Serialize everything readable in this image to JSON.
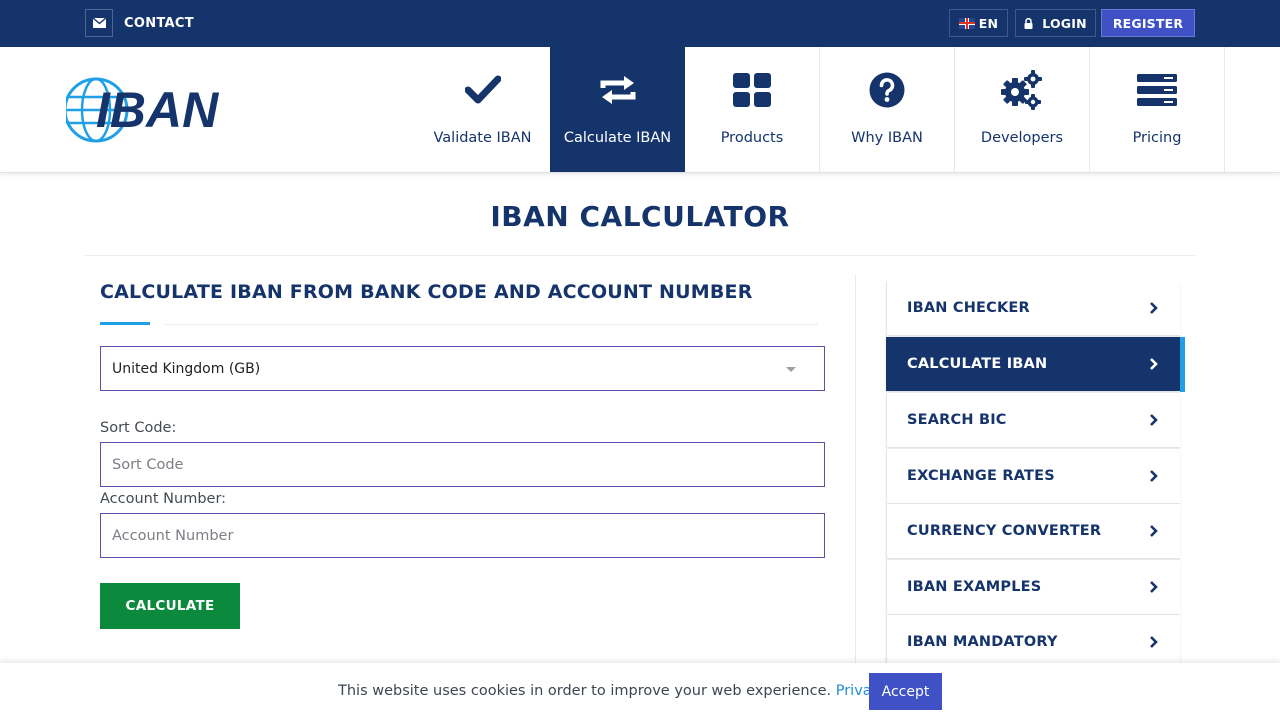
{
  "colors": {
    "navy": "#15346b",
    "topbar": "#15346b",
    "register": "#3f51c4",
    "accent_blue": "#1fa0e6",
    "calculate_green": "#0b8a3e",
    "input_border": "#5a4fb0"
  },
  "topbar": {
    "contact_label": "CONTACT",
    "contact_icon": "envelope-icon",
    "lang_label": "EN",
    "login_label": "LOGIN",
    "login_icon": "lock-icon",
    "register_label": "REGISTER"
  },
  "header": {
    "logo_text": "IBAN",
    "nav": [
      {
        "label": "Validate IBAN",
        "icon": "checkmark-icon",
        "active": false
      },
      {
        "label": "Calculate IBAN",
        "icon": "swap-arrows-icon",
        "active": true
      },
      {
        "label": "Products",
        "icon": "grid-icon",
        "active": false
      },
      {
        "label": "Why IBAN",
        "icon": "question-icon",
        "active": false
      },
      {
        "label": "Developers",
        "icon": "gears-icon",
        "active": false
      },
      {
        "label": "Pricing",
        "icon": "server-stack-icon",
        "active": false
      }
    ]
  },
  "main": {
    "page_title": "IBAN CALCULATOR",
    "section_title": "CALCULATE IBAN FROM BANK CODE AND ACCOUNT NUMBER",
    "country_select": {
      "value": "United Kingdom (GB)"
    },
    "sort_code": {
      "label": "Sort Code:",
      "placeholder": "Sort Code",
      "value": ""
    },
    "account_number": {
      "label": "Account Number:",
      "placeholder": "Account Number",
      "value": ""
    },
    "calculate_label": "CALCULATE"
  },
  "sidebar": {
    "items": [
      {
        "label": "IBAN CHECKER",
        "active": false
      },
      {
        "label": "CALCULATE IBAN",
        "active": true
      },
      {
        "label": "SEARCH BIC",
        "active": false
      },
      {
        "label": "EXCHANGE RATES",
        "active": false
      },
      {
        "label": "CURRENCY CONVERTER",
        "active": false
      },
      {
        "label": "IBAN EXAMPLES",
        "active": false
      },
      {
        "label": "IBAN MANDATORY",
        "active": false
      }
    ]
  },
  "cookie": {
    "message": "This website uses cookies in order to improve your web experience.",
    "policy_label": "Privacy policy",
    "accept_label": "Accept"
  }
}
